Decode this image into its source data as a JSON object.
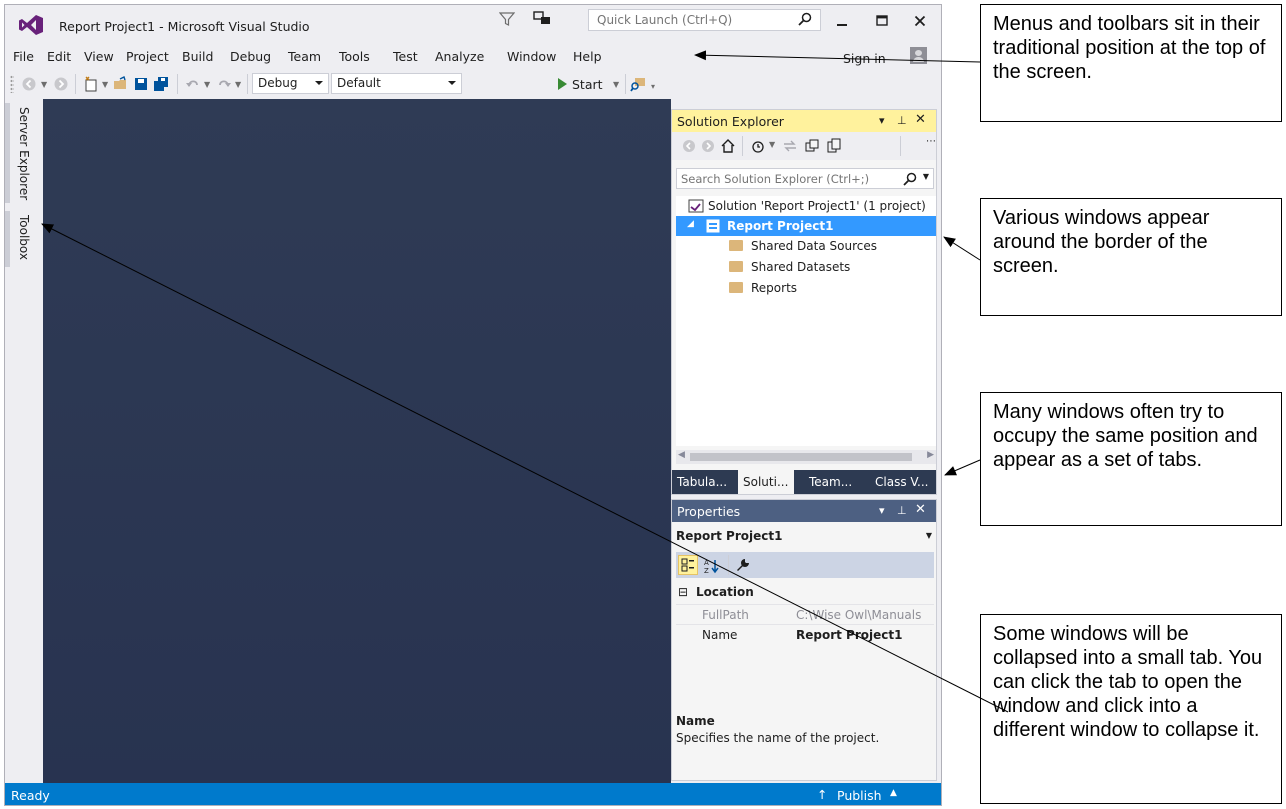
{
  "window": {
    "title": "Report Project1 - Microsoft Visual Studio",
    "quick_launch_placeholder": "Quick Launch (Ctrl+Q)"
  },
  "menu": {
    "items": [
      "File",
      "Edit",
      "View",
      "Project",
      "Build",
      "Debug",
      "Team",
      "Tools",
      "Test",
      "Analyze",
      "Window",
      "Help"
    ],
    "sign_in": "Sign in"
  },
  "toolbar": {
    "config": "Debug",
    "platform": "Default",
    "start": "Start"
  },
  "left_tabs": [
    "Server Explorer",
    "Toolbox"
  ],
  "solution_explorer": {
    "title": "Solution Explorer",
    "search_placeholder": "Search Solution Explorer (Ctrl+;)",
    "tree": [
      "Solution 'Report Project1' (1 project)",
      "Report Project1",
      "Shared Data Sources",
      "Shared Datasets",
      "Reports"
    ],
    "tabs": [
      "Tabula...",
      "Soluti...",
      "Team...",
      "Class V..."
    ],
    "active_tab": "Soluti..."
  },
  "properties": {
    "title": "Properties",
    "object": "Report Project1",
    "category": "Location",
    "rows": [
      {
        "key": "FullPath",
        "value": "C:\\Wise Owl\\Manuals"
      },
      {
        "key": "Name",
        "value": "Report Project1"
      }
    ],
    "description_title": "Name",
    "description_text": "Specifies the name of the project."
  },
  "status": {
    "left": "Ready",
    "right": "Publish"
  },
  "callouts": [
    "Menus and toolbars sit in their traditional position at the top of the screen.",
    "Various windows appear around the border of the screen.",
    "Many windows often try to occupy the same position and appear as a set of tabs.",
    "Some windows will be collapsed into a small tab.  You can click the tab to open the window and click into a different window to collapse it."
  ],
  "colors": {
    "accent": "#007acc",
    "selection": "#3399ff",
    "solution_explorer_header": "#fff29d",
    "properties_header": "#4d6082",
    "editor_background": "#2d3a52"
  }
}
